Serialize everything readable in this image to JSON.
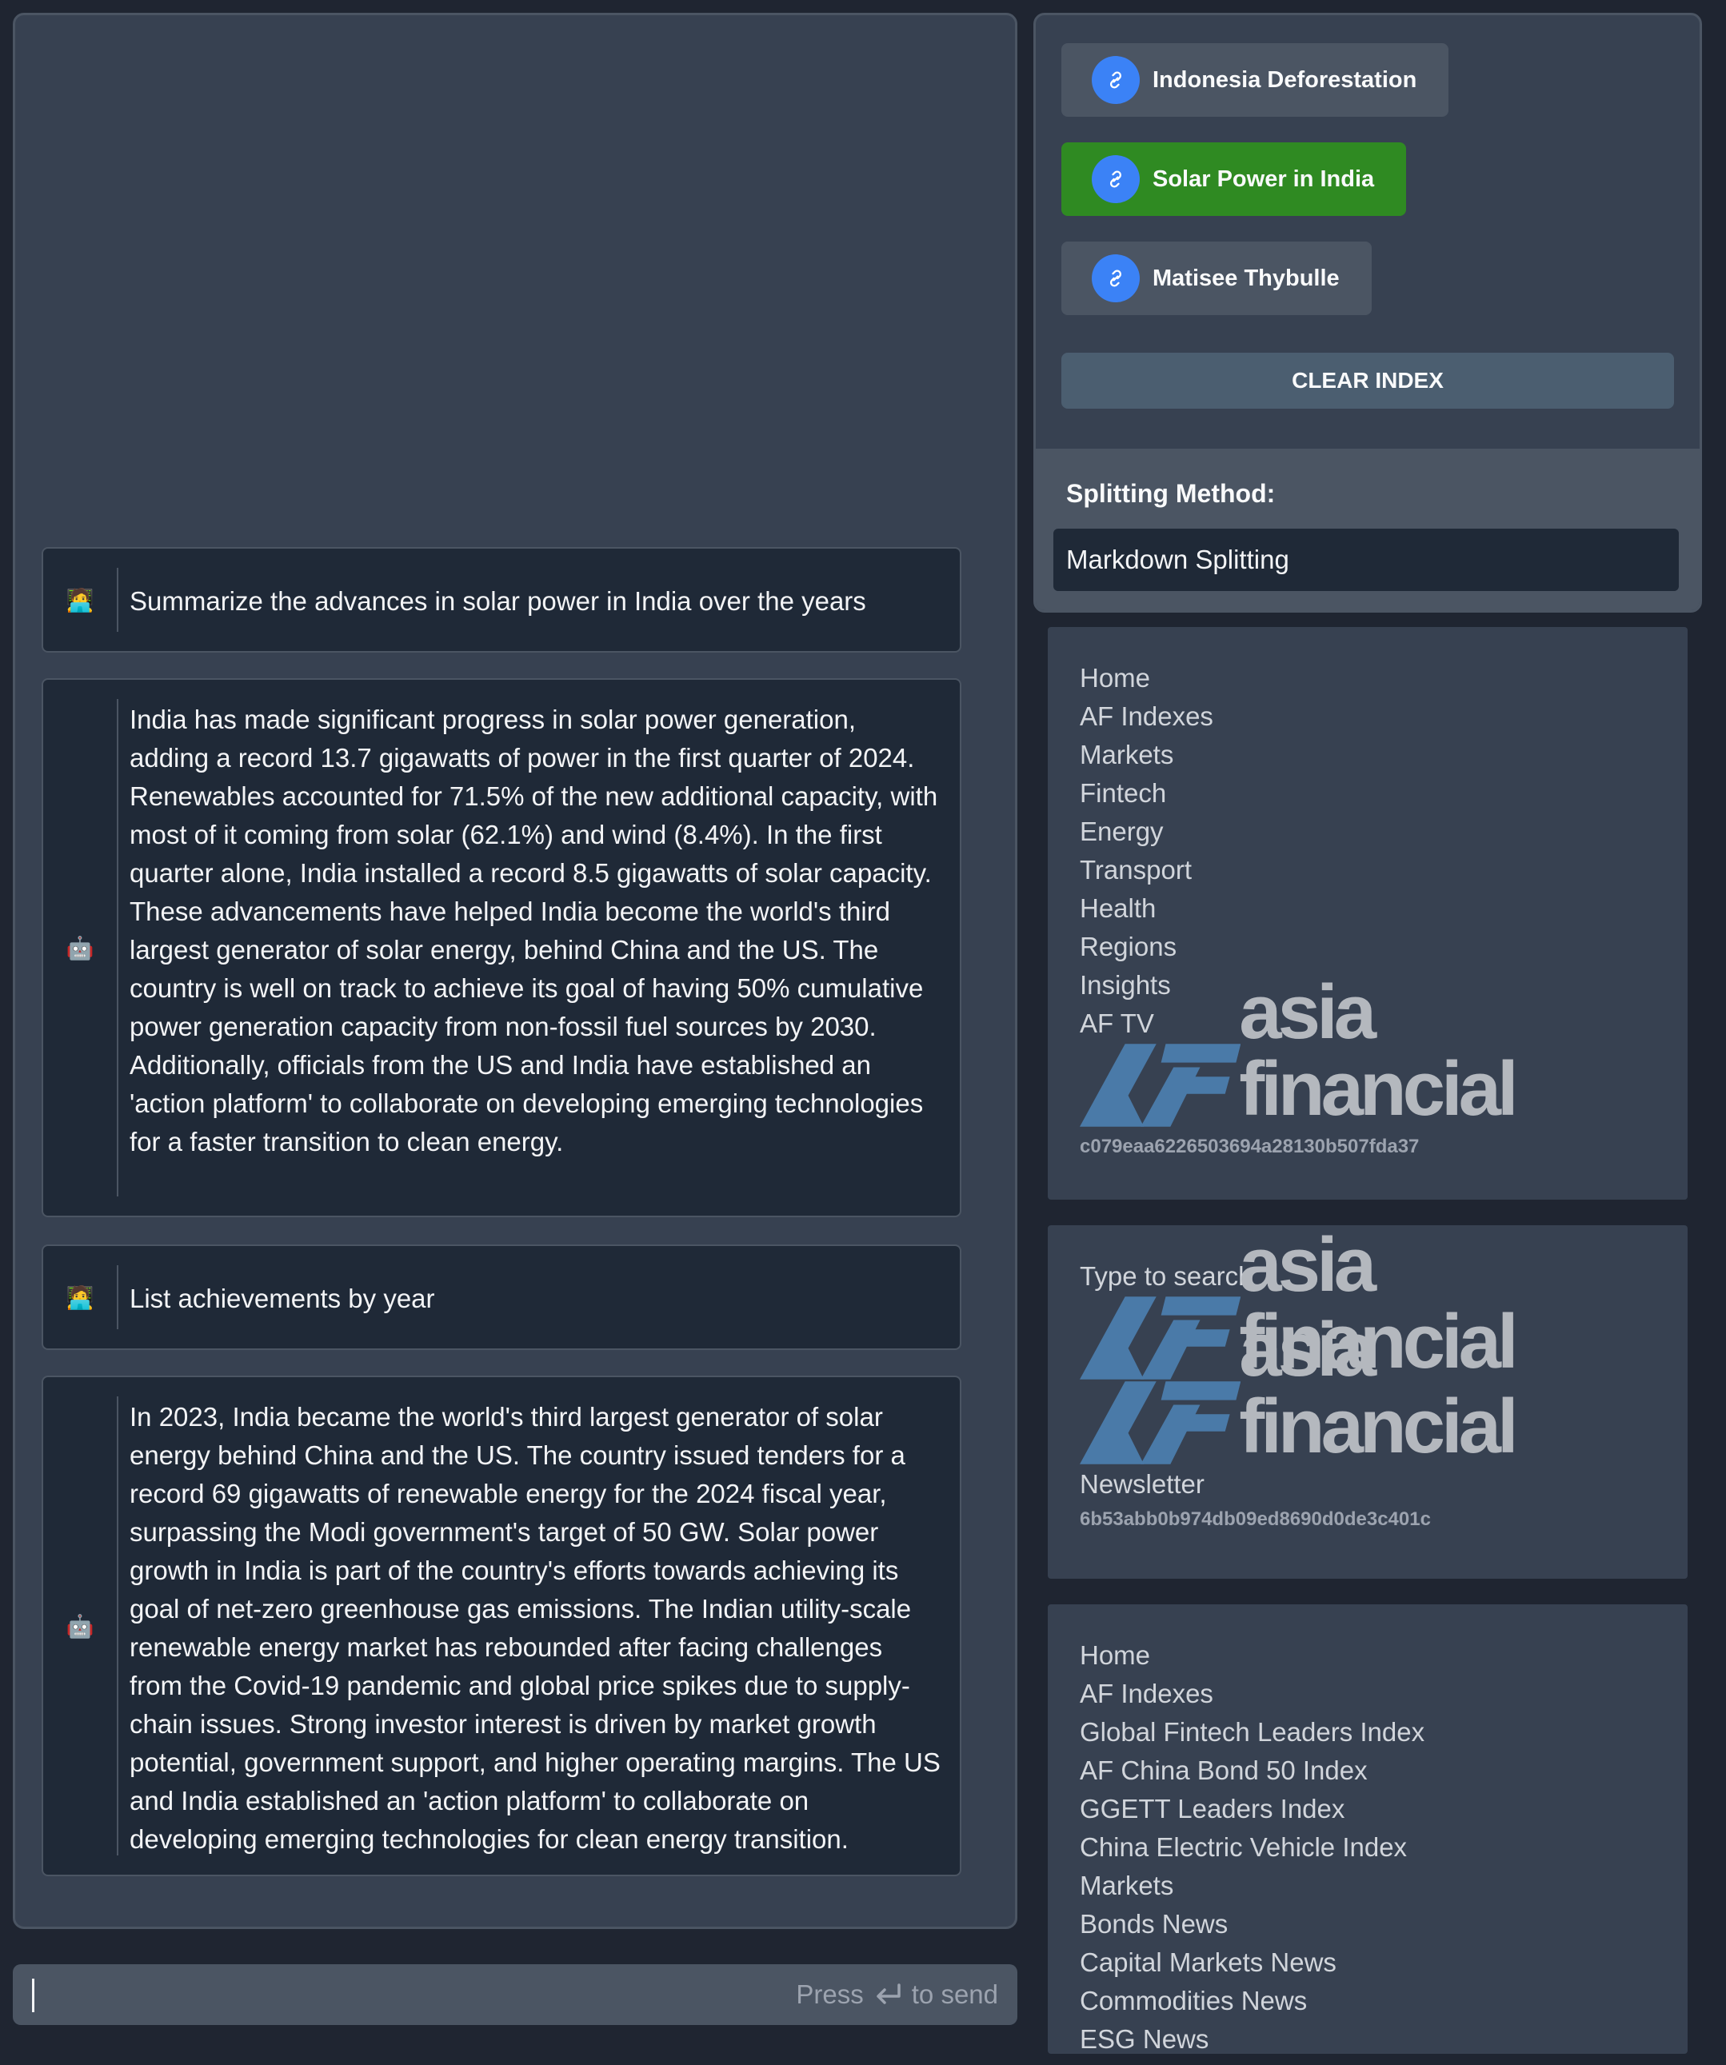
{
  "chat": {
    "messages": [
      {
        "role": "user",
        "avatar": "🧑‍💻",
        "text": "Summarize the advances in solar power in India over the years"
      },
      {
        "role": "assistant",
        "avatar": "🤖",
        "text": "India has made significant progress in solar power generation, adding a record 13.7 gigawatts of power in the first quarter of 2024. Renewables accounted for 71.5% of the new additional capacity, with most of it coming from solar (62.1%) and wind (8.4%). In the first quarter alone, India installed a record 8.5 gigawatts of solar capacity. These advancements have helped India become the world's third largest generator of solar energy, behind China and the US. The country is well on track to achieve its goal of having 50% cumulative power generation capacity from non-fossil fuel sources by 2030. Additionally, officials from the US and India have established an 'action platform' to collaborate on developing emerging technologies for a faster transition to clean energy."
      },
      {
        "role": "user",
        "avatar": "🧑‍💻",
        "text": "List achievements by year"
      },
      {
        "role": "assistant",
        "avatar": "🤖",
        "text": "In 2023, India became the world's third largest generator of solar energy behind China and the US. The country issued tenders for a record 69 gigawatts of renewable energy for the 2024 fiscal year, surpassing the Modi government's target of 50 GW. Solar power growth in India is part of the country's efforts towards achieving its goal of net-zero greenhouse gas emissions. The Indian utility-scale renewable energy market has rebounded after facing challenges from the Covid-19 pandemic and global price spikes due to supply-chain issues. Strong investor interest is driven by market growth potential, government support, and higher operating margins. The US and India established an 'action platform' to collaborate on developing emerging technologies for clean energy transition."
      }
    ]
  },
  "input": {
    "hint_press": "Press",
    "hint_send": "to send"
  },
  "indexes": [
    {
      "label": "Indonesia Deforestation",
      "active": false
    },
    {
      "label": "Solar Power in India",
      "active": true
    },
    {
      "label": "Matisee Thybulle",
      "active": false
    }
  ],
  "clear_label": "CLEAR INDEX",
  "splitting": {
    "label": "Splitting Method:",
    "value": "Markdown Splitting"
  },
  "docs": [
    {
      "lines": [
        "Home",
        "AF Indexes",
        "Markets",
        "Fintech",
        "Energy",
        "Transport",
        "Health",
        "Regions",
        "Insights",
        "AF TV"
      ],
      "logo": "asia financial",
      "hash": "c079eaa6226503694a28130b507fda37"
    },
    {
      "search": "Type to search",
      "logo": "asia financial",
      "footer": "Newsletter",
      "hash": "6b53abb0b974db09ed8690d0de3c401c"
    },
    {
      "lines": [
        "Home",
        "AF Indexes",
        "Global Fintech Leaders Index",
        "AF China Bond 50 Index",
        "GGETT Leaders Index",
        "China Electric Vehicle Index",
        "Markets",
        "Bonds News",
        "Capital Markets News",
        "Commodities News",
        "ESG News"
      ]
    }
  ],
  "colors": {
    "active_index": "#2f8a22",
    "link_icon": "#3b82f6",
    "logo_mark": "#4a7aa8",
    "logo_text": "#b4b8be"
  }
}
